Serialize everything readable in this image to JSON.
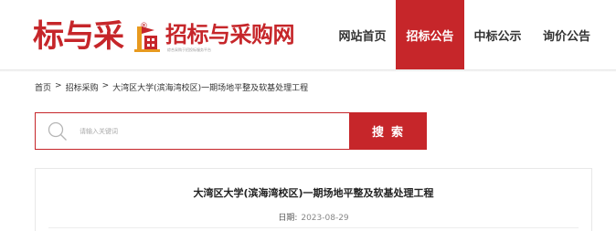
{
  "header": {
    "logo_text": "标与采",
    "logo_registered": "®",
    "sub_logo_title": "招标与采购网",
    "sub_logo_tagline": "综合采购于招投标服务平台",
    "logo_icon": "building-flag-icon",
    "nav": [
      {
        "label": "网站首页",
        "active": false
      },
      {
        "label": "招标公告",
        "active": true
      },
      {
        "label": "中标公示",
        "active": false
      },
      {
        "label": "询价公告",
        "active": false
      }
    ]
  },
  "breadcrumb": {
    "items": [
      "首页",
      "招标采购",
      "大湾区大学(滨海湾校区)一期场地平整及软基处理工程"
    ],
    "separator": ">"
  },
  "search": {
    "placeholder": "请输入关键词",
    "button_label": "搜索",
    "icon": "search-icon"
  },
  "article": {
    "title": "大湾区大学(滨海湾校区)一期场地平整及软基处理工程",
    "date_label": "日期:",
    "date_value": "2023-08-29"
  },
  "colors": {
    "brand": "#c6262a",
    "text": "#333333",
    "muted": "#888888"
  }
}
